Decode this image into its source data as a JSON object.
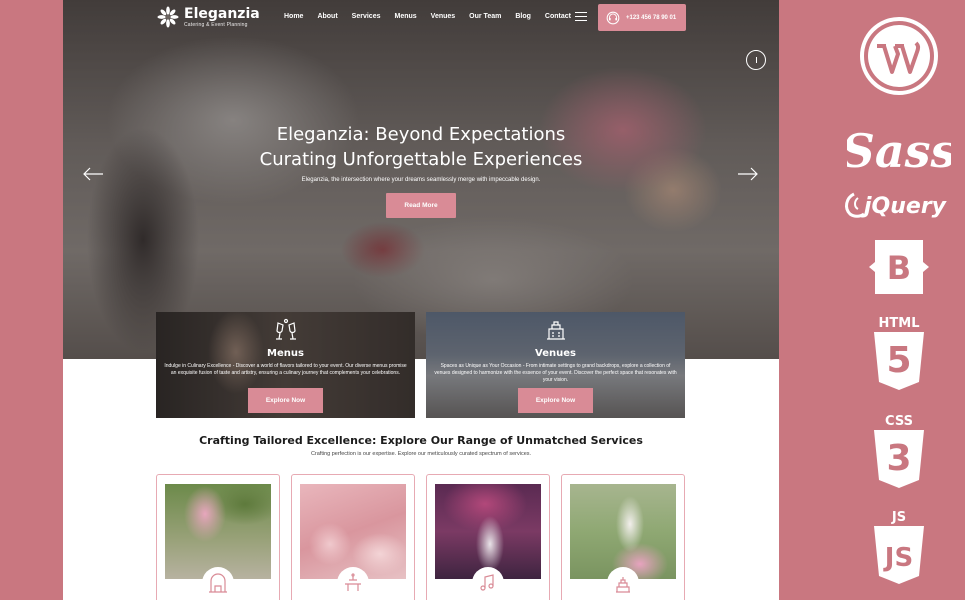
{
  "brand": {
    "name": "Eleganzia",
    "tagline": "Catering & Event Planning"
  },
  "nav": {
    "items": [
      "Home",
      "About",
      "Services",
      "Menus",
      "Venues",
      "Our Team",
      "Blog",
      "Contact"
    ]
  },
  "header": {
    "phone": "+123 456 78 90 01"
  },
  "hero": {
    "title_line1": "Eleganzia: Beyond Expectations",
    "title_line2": "Curating Unforgettable Experiences",
    "subtitle": "Eleganzia, the intersection where your dreams seamlessly merge with impeccable design.",
    "button": "Read More"
  },
  "features": [
    {
      "title": "Menus",
      "desc": "Indulge in Culinary Excellence - Discover a world of flavors tailored to your event. Our diverse menus promise an exquisite fusion of taste and artistry, ensuring a culinary journey that complements your celebrations.",
      "button": "Explore Now"
    },
    {
      "title": "Venues",
      "desc": "Spaces as Unique as Your Occasion - From intimate settings to grand backdrops, explore a collection of venues designed to harmonize with the essence of your event. Discover the perfect space that resonates with your vision.",
      "button": "Explore Now"
    }
  ],
  "services": {
    "title": "Crafting Tailored Excellence: Explore Our Range of Unmatched Services",
    "subtitle": "Crafting perfection is our expertise. Explore our meticulously curated spectrum of services."
  },
  "tech_stack": {
    "icons": [
      "wordpress-icon",
      "sass-icon",
      "jquery-icon",
      "bootstrap-icon",
      "html5-icon",
      "css3-icon",
      "js-icon"
    ],
    "sass": "Sass",
    "jquery": "jQuery",
    "bootstrap": "B",
    "html": "HTML",
    "html_num": "5",
    "css": "CSS",
    "css_num": "3",
    "js": "JS",
    "js_glyph": "JS"
  },
  "colors": {
    "background": "#c97780",
    "accent": "#d98b96",
    "card_border": "#e7aab3"
  }
}
